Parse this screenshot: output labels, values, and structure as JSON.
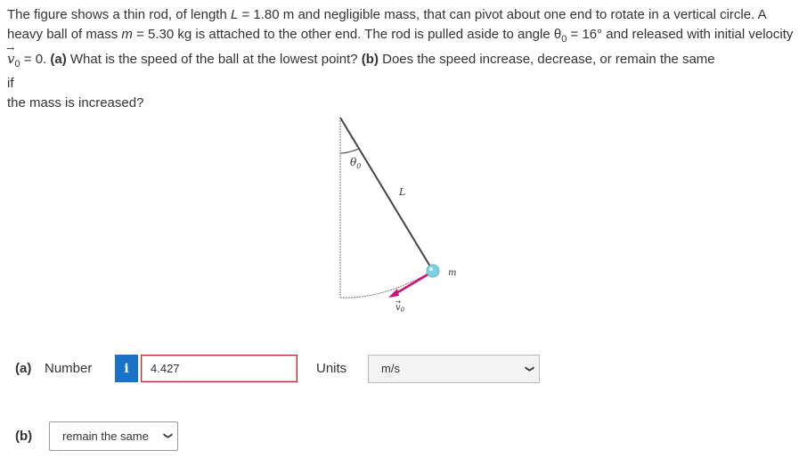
{
  "question": {
    "s1": "The figure shows a thin rod, of length ",
    "L_sym": "L",
    "s2": " = 1.80 m and negligible mass, that can pivot about one end to rotate in a vertical circle. A heavy ball of mass ",
    "m_sym": "m",
    "s3": " = 5.30 kg is attached to the other end. The rod is pulled aside to angle θ",
    "theta_sub": "0",
    "s4": " = 16° and released with initial velocity ",
    "v_sym": "v",
    "v_sub": "0",
    "s5": " = 0. ",
    "part_a": "(a)",
    "s6": " What is the speed of the ball at the lowest point? ",
    "part_b": "(b)",
    "s7": " Does the speed increase, decrease, or remain the same",
    "line_if": "if",
    "line_mass": "the mass is increased?"
  },
  "figure": {
    "theta_label": "θ",
    "theta_sub": "0",
    "length_label": "L",
    "mass_label": "m",
    "v_label": "v",
    "v_sub": "0",
    "colors": {
      "rod": "#444444",
      "ball": "#7fd0e0",
      "velocity": "#cc1177"
    }
  },
  "answer_a": {
    "part_label": "(a)",
    "field_label": "Number",
    "info_icon": "i",
    "value": "4.427",
    "units_label": "Units",
    "units_value": "m/s"
  },
  "answer_b": {
    "part_label": "(b)",
    "selected": "remain the same"
  }
}
